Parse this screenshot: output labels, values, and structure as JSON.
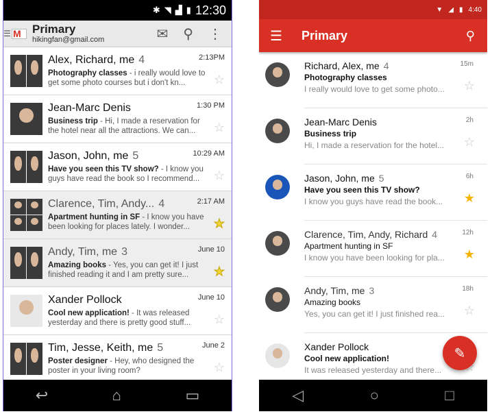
{
  "left": {
    "status_time": "12:30",
    "title": "Primary",
    "account": "hikingfan@gmail.com",
    "emails": [
      {
        "from": "Alex, Richard, me",
        "count": "4",
        "time": "2:13PM",
        "subject": "Photography classes",
        "snippet": " - i really would love to get some photo courses but i don't kn...",
        "starred": false,
        "read": false
      },
      {
        "from": "Jean-Marc Denis",
        "count": "",
        "time": "1:30 PM",
        "subject": "Business trip",
        "snippet": " - Hi, I made a reservation for the hotel near all the attractions. We can...",
        "starred": false,
        "read": false
      },
      {
        "from": "Jason, John, me",
        "count": "5",
        "time": "10:29 AM",
        "subject": "Have you seen this TV show?",
        "snippet": " - I know you guys have read the book so I recommend...",
        "starred": false,
        "read": false
      },
      {
        "from": "Clarence, Tim, Andy...",
        "count": "4",
        "time": "2:17 AM",
        "subject": "Apartment hunting in SF",
        "snippet": " - I know you have been looking for places lately. I wonder...",
        "starred": true,
        "read": true
      },
      {
        "from": "Andy, Tim, me",
        "count": "3",
        "time": "June 10",
        "subject": "Amazing books",
        "snippet": " - Yes, you can get it! I just finished reading it and I am pretty sure...",
        "starred": true,
        "read": true
      },
      {
        "from": "Xander Pollock",
        "count": "",
        "time": "June 10",
        "subject": "Cool new application!",
        "snippet": " - It was released yesterday and there is pretty good stuff...",
        "starred": false,
        "read": false
      },
      {
        "from": "Tim, Jesse, Keith, me",
        "count": "5",
        "time": "June 2",
        "subject": "Poster designer",
        "snippet": " - Hey, who designed the poster in your living room?",
        "starred": false,
        "read": false
      }
    ]
  },
  "right": {
    "status_time": "4:40",
    "title": "Primary",
    "emails": [
      {
        "from": "Richard, Alex, me",
        "count": "4",
        "time": "15m",
        "subject": "Photography classes",
        "preview": "I really would love to get some photo...",
        "starred": false,
        "read": false
      },
      {
        "from": "Jean-Marc Denis",
        "count": "",
        "time": "2h",
        "subject": "Business trip",
        "preview": "Hi, I made a reservation for the hotel...",
        "starred": false,
        "read": false
      },
      {
        "from": "Jason, John, me",
        "count": "5",
        "time": "6h",
        "subject": "Have you seen this TV show?",
        "preview": "I know you guys have read the book...",
        "starred": true,
        "read": false
      },
      {
        "from": "Clarence, Tim, Andy, Richard",
        "count": "4",
        "time": "12h",
        "subject": "Apartment hunting in SF",
        "preview": "I know you have been looking for pla...",
        "starred": true,
        "read": true
      },
      {
        "from": "Andy, Tim, me",
        "count": "3",
        "time": "18h",
        "subject": "Amazing books",
        "preview": "Yes, you can get it! I just finished rea...",
        "starred": false,
        "read": true
      },
      {
        "from": "Xander Pollock",
        "count": "",
        "time": "",
        "subject": "Cool new application!",
        "preview": "It was released yesterday and there...",
        "starred": false,
        "read": false
      }
    ]
  }
}
